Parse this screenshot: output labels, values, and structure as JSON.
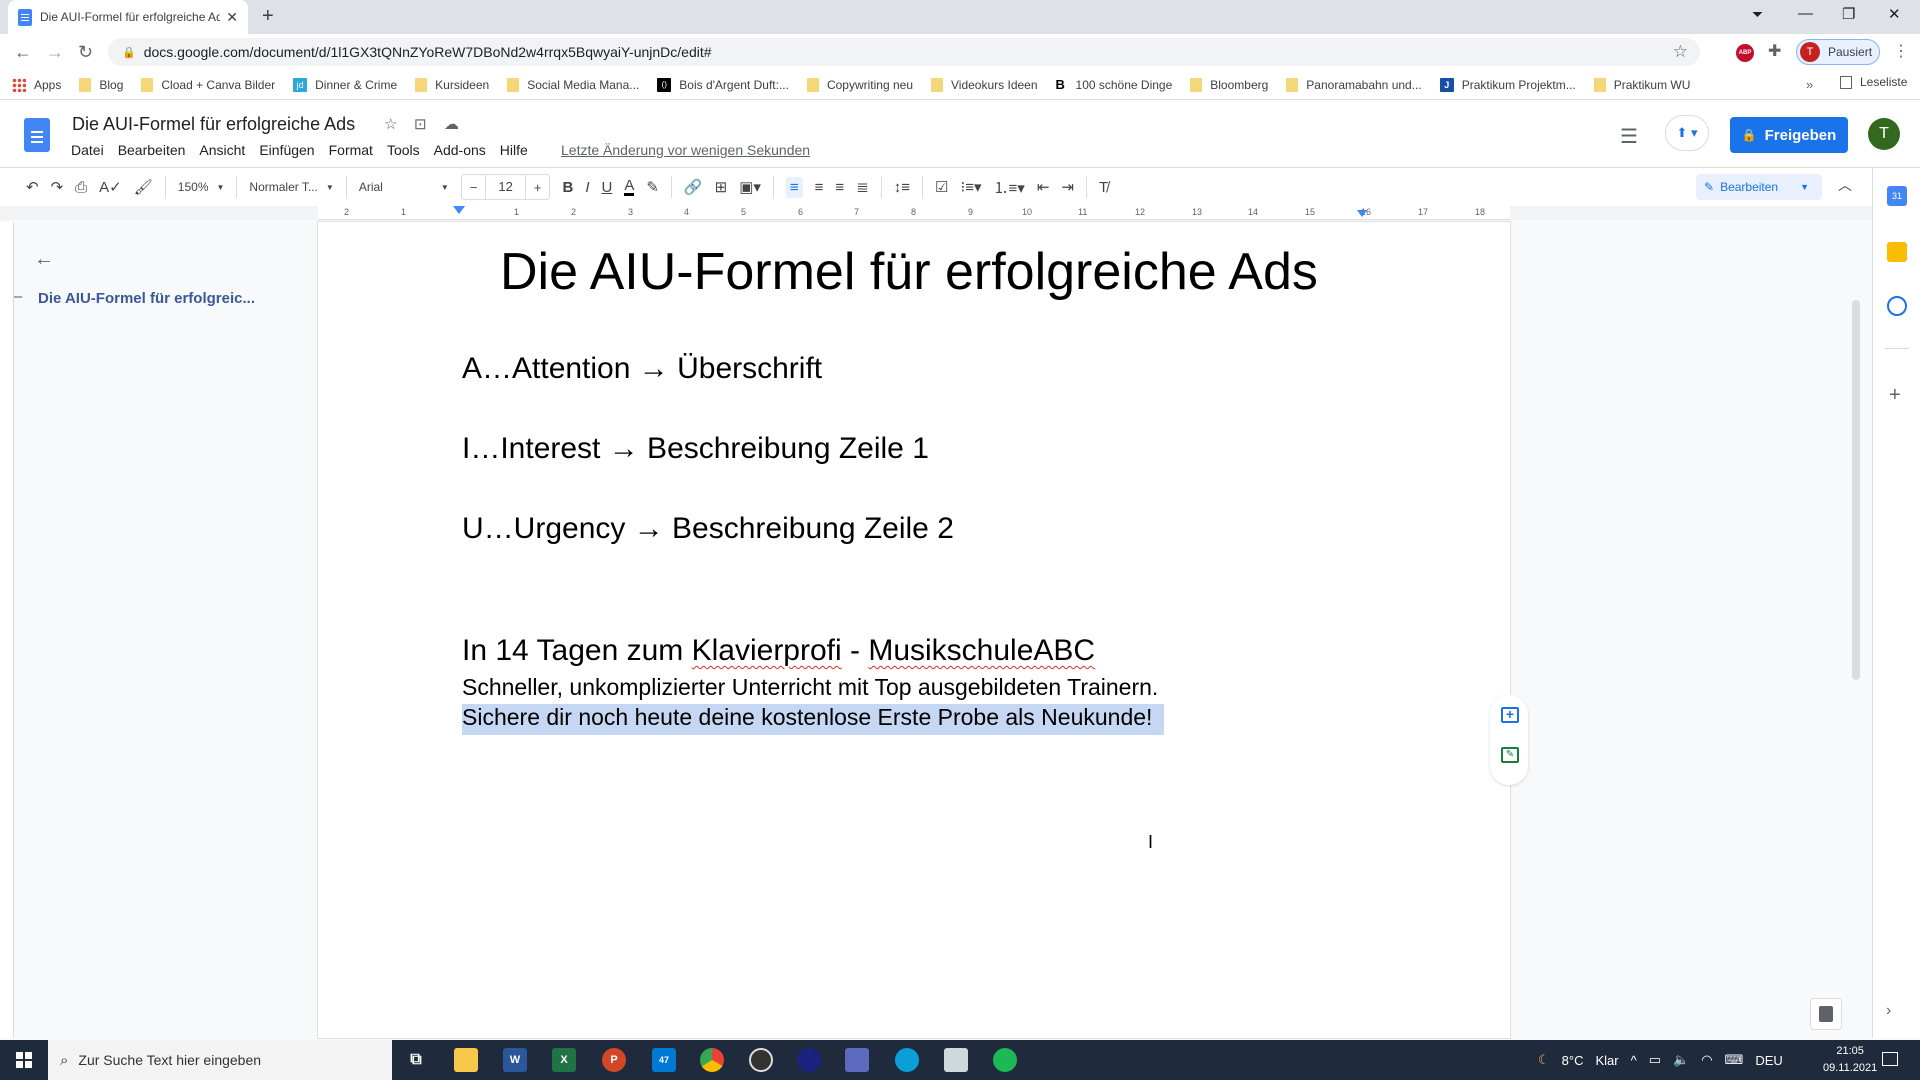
{
  "browser": {
    "tab_title": "Die AUI-Formel für erfolgreiche Ads",
    "url": "docs.google.com/document/d/1l1GX3tQNnZYoReW7DBoNd2w4rrqx5BqwyaiY-unjnDc/edit#",
    "profile_initial": "T",
    "profile_status": "Pausiert",
    "abp_label": "ABP",
    "bookmarks": [
      {
        "label": "Apps",
        "icon": "apps-grid-icon"
      },
      {
        "label": "Blog",
        "icon": "folder-icon"
      },
      {
        "label": "Cload + Canva Bilder",
        "icon": "folder-icon"
      },
      {
        "label": "Dinner & Crime",
        "icon": "jd-site-icon"
      },
      {
        "label": "Kursideen",
        "icon": "folder-icon"
      },
      {
        "label": "Social Media Mana...",
        "icon": "folder-icon"
      },
      {
        "label": "Bois d'Argent Duft:...",
        "icon": "bois-dargent-icon"
      },
      {
        "label": "Copywriting neu",
        "icon": "folder-icon"
      },
      {
        "label": "Videokurs Ideen",
        "icon": "folder-icon"
      },
      {
        "label": "100 schöne Dinge",
        "icon": "b-site-icon"
      },
      {
        "label": "Bloomberg",
        "icon": "folder-icon"
      },
      {
        "label": "Panoramabahn und...",
        "icon": "folder-icon"
      },
      {
        "label": "Praktikum Projektm...",
        "icon": "j-site-icon"
      },
      {
        "label": "Praktikum WU",
        "icon": "folder-icon"
      }
    ],
    "bookmarks_more": "»",
    "reading_list": "Leseliste"
  },
  "docs": {
    "title": "Die AUI-Formel für erfolgreiche Ads",
    "menu": [
      "Datei",
      "Bearbeiten",
      "Ansicht",
      "Einfügen",
      "Format",
      "Tools",
      "Add-ons",
      "Hilfe"
    ],
    "last_edit": "Letzte Änderung vor wenigen Sekunden",
    "share_label": "Freigeben",
    "user_initial": "T",
    "accent_color": "#1a73e8"
  },
  "toolbar": {
    "zoom": "150%",
    "style": "Normaler T...",
    "font": "Arial",
    "font_size": "12",
    "minus": "−",
    "plus": "+",
    "bold": "B",
    "italic": "I",
    "underline": "U",
    "text_color": "A",
    "mode": "Bearbeiten"
  },
  "ruler": {
    "ticks": [
      "2",
      "1",
      "1",
      "2",
      "3",
      "4",
      "5",
      "6",
      "7",
      "8",
      "9",
      "10",
      "11",
      "12",
      "13",
      "14",
      "15",
      "16",
      "17",
      "18"
    ]
  },
  "outline": {
    "items": [
      "Die AIU-Formel für erfolgreic..."
    ]
  },
  "document": {
    "heading": "Die AIU-Formel für erfolgreiche Ads",
    "lines": [
      "A…Attention → Überschrift",
      "I…Interest → Beschreibung Zeile 1",
      "U…Urgency → Beschreibung Zeile 2"
    ],
    "ad_headline_part1": "In 14 Tagen zum ",
    "ad_headline_word1": "Klavierprofi",
    "ad_headline_part2": " - ",
    "ad_headline_word2": "MusikschuleABC",
    "ad_line1": "Schneller, unkomplizierter Unterricht mit Top ausgebildeten Trainern.",
    "ad_line2": "Sichere dir noch heute deine kostenlose Erste Probe als Neukunde!"
  },
  "taskbar": {
    "search_placeholder": "Zur Suche Text hier eingeben",
    "mail_badge": "47",
    "weather": "8°C",
    "weather_desc": "Klar",
    "language": "DEU",
    "time": "21:05",
    "date": "09.11.2021"
  }
}
